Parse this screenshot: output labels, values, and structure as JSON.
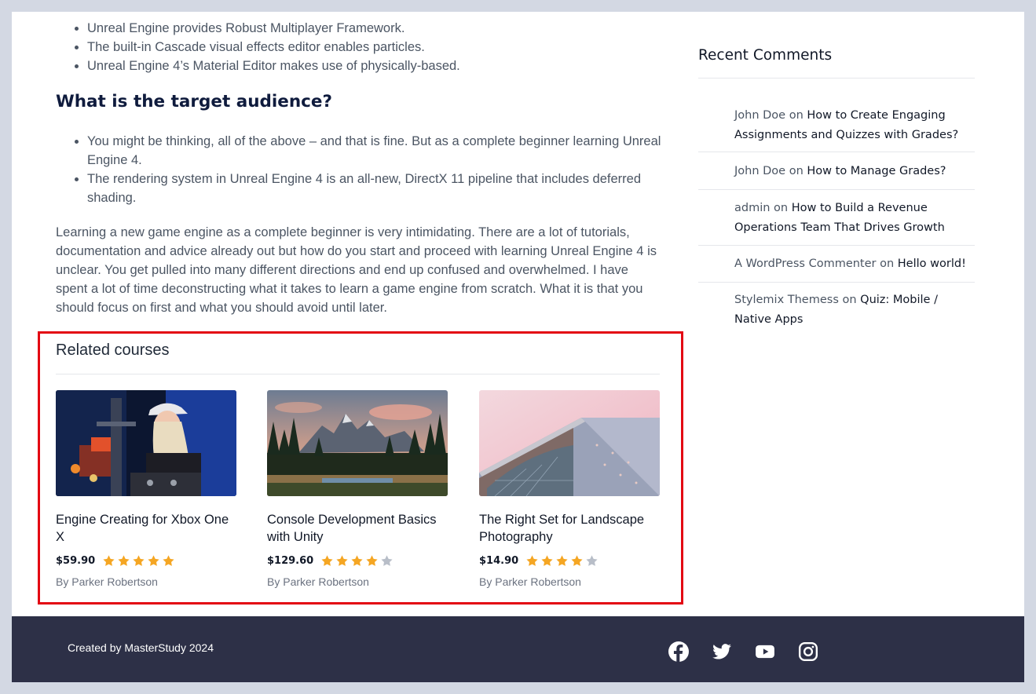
{
  "article": {
    "bullets1": [
      "Unreal Engine provides Robust Multiplayer Framework.",
      "The built-in Cascade visual effects editor enables particles.",
      "Unreal Engine 4’s Material Editor makes use of physically-based."
    ],
    "heading": "What is the target audience?",
    "bullets2": [
      "You might be thinking, all of the above – and that is fine. But as a complete beginner learning Unreal Engine 4.",
      "The rendering system in Unreal Engine 4 is an all-new, DirectX 11 pipeline that includes deferred shading."
    ],
    "paragraph": "Learning a new game engine as a complete beginner is very intimidating. There are a lot of tutorials, documentation and advice already out but how do you start and proceed with learning Unreal Engine 4 is unclear. You get pulled into many different directions and end up confused and overwhelmed. I have spent a lot of time deconstructing what it takes to learn a game engine from scratch. What it is that you should focus on first and what you should avoid until later."
  },
  "related": {
    "title": "Related courses",
    "courses": [
      {
        "title": "Engine Creating for Xbox One X",
        "price": "$59.90",
        "rating": 5,
        "author": "By Parker Robertson",
        "image": "dj-image"
      },
      {
        "title": "Console Development Basics with Unity",
        "price": "$129.60",
        "rating": 4,
        "author": "By Parker Robertson",
        "image": "mountains-image"
      },
      {
        "title": "The Right Set for Landscape Photography",
        "price": "$14.90",
        "rating": 4,
        "author": "By Parker Robertson",
        "image": "building-image"
      }
    ],
    "star_color": "#f5a623",
    "star_empty_color": "#b8bec8",
    "highlight_color": "#e30613"
  },
  "sidebar": {
    "title": "Recent Comments",
    "comments": [
      {
        "author": "John Doe",
        "on": "on",
        "post": "How to Create Engaging Assignments and Quizzes with Grades?"
      },
      {
        "author": "John Doe",
        "on": "on",
        "post": "How to Manage Grades?"
      },
      {
        "author": "admin",
        "on": "on",
        "post": "How to Build a Revenue Operations Team That Drives Growth"
      },
      {
        "author": "A WordPress Commenter",
        "on": "on",
        "post": "Hello world!"
      },
      {
        "author": "Stylemix Themess",
        "on": "on",
        "post": "Quiz: Mobile / Native Apps"
      }
    ]
  },
  "footer": {
    "text": "Created by MasterStudy 2024",
    "background": "#2d3047",
    "social": [
      "facebook-icon",
      "twitter-icon",
      "youtube-icon",
      "instagram-icon"
    ]
  }
}
